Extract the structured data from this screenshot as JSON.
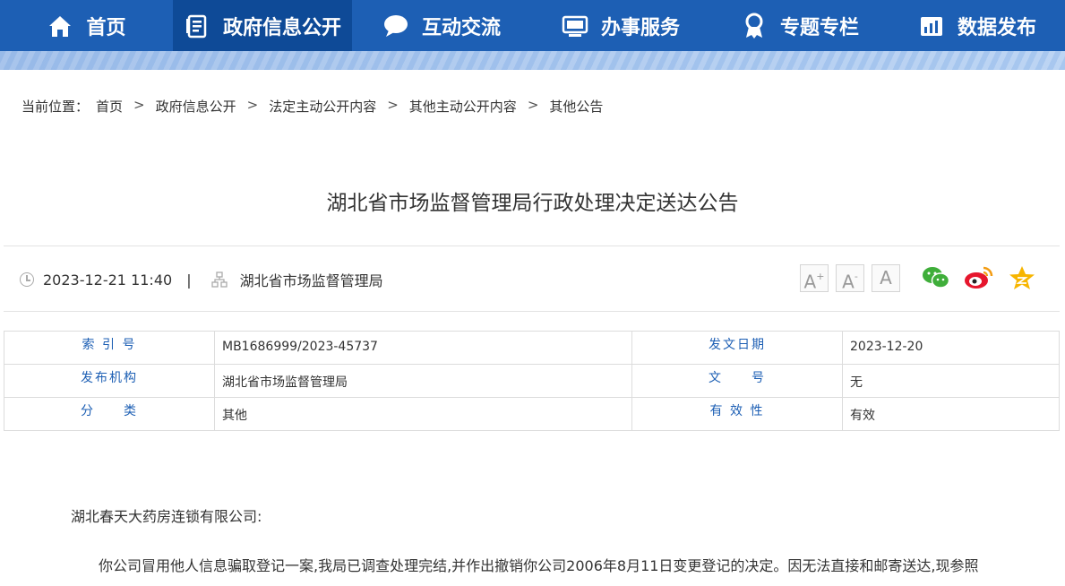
{
  "nav": {
    "items": [
      {
        "label": "首页",
        "icon": "home-icon"
      },
      {
        "label": "政府信息公开",
        "icon": "document-icon"
      },
      {
        "label": "互动交流",
        "icon": "chat-bubble-icon"
      },
      {
        "label": "办事服务",
        "icon": "monitor-icon"
      },
      {
        "label": "专题专栏",
        "icon": "award-icon"
      },
      {
        "label": "数据发布",
        "icon": "bar-chart-icon"
      }
    ],
    "active_index": 1,
    "color": "#1d5fb4",
    "active_color": "#0e4a97"
  },
  "breadcrumb": {
    "prefix": "当前位置：",
    "items": [
      "首页",
      "政府信息公开",
      "法定主动公开内容",
      "其他主动公开内容",
      "其他公告"
    ],
    "separator": ">"
  },
  "article": {
    "title": "湖北省市场监督管理局行政处理决定送达公告",
    "datetime": "2023-12-21 11:40",
    "meta_separator": "|",
    "source": "湖北省市场监督管理局"
  },
  "tools": {
    "font_large": "A",
    "font_large_mark": "+",
    "font_small": "A",
    "font_small_mark": "-",
    "font_default": "A",
    "share": [
      "wechat-icon",
      "weibo-icon",
      "qzone-icon"
    ]
  },
  "info_table": {
    "rows": [
      {
        "k1": "索 引 号",
        "v1": "MB1686999/2023-45737",
        "k2": "发文日期",
        "v2": "2023-12-20"
      },
      {
        "k1": "发布机构",
        "v1": "湖北省市场监督管理局",
        "k2": "文　　号",
        "v2": "无"
      },
      {
        "k1": "分　　类",
        "v1": "其他",
        "k2": "有 效 性",
        "v2": "有效"
      }
    ]
  },
  "body": {
    "salutation": "湖北春天大药房连锁有限公司:",
    "paragraph1": "你公司冒用他人信息骗取登记一案,我局已调查处理完结,并作出撤销你公司2006年8月11日变更登记的决定。因无法直接和邮寄送达,现参照"
  }
}
